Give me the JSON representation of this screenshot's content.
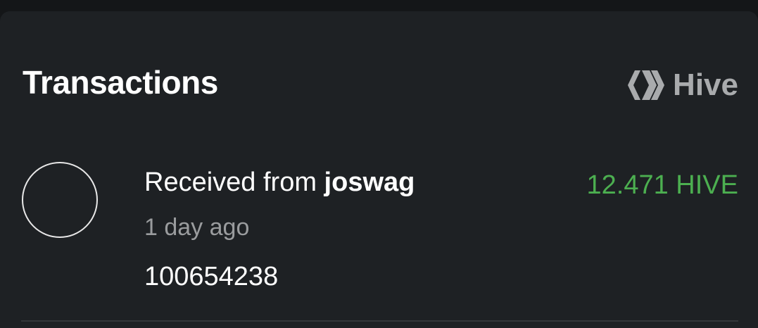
{
  "header": {
    "title": "Transactions",
    "brand_label": "Hive",
    "brand_icon": "hive-logo-icon"
  },
  "transactions": [
    {
      "avatar": "avatar-circle",
      "prefix": "Received from ",
      "counterparty": "joswag",
      "amount": "12.471 HIVE",
      "amount_color": "#4caf50",
      "time": "1 day ago",
      "memo": "100654238"
    }
  ]
}
